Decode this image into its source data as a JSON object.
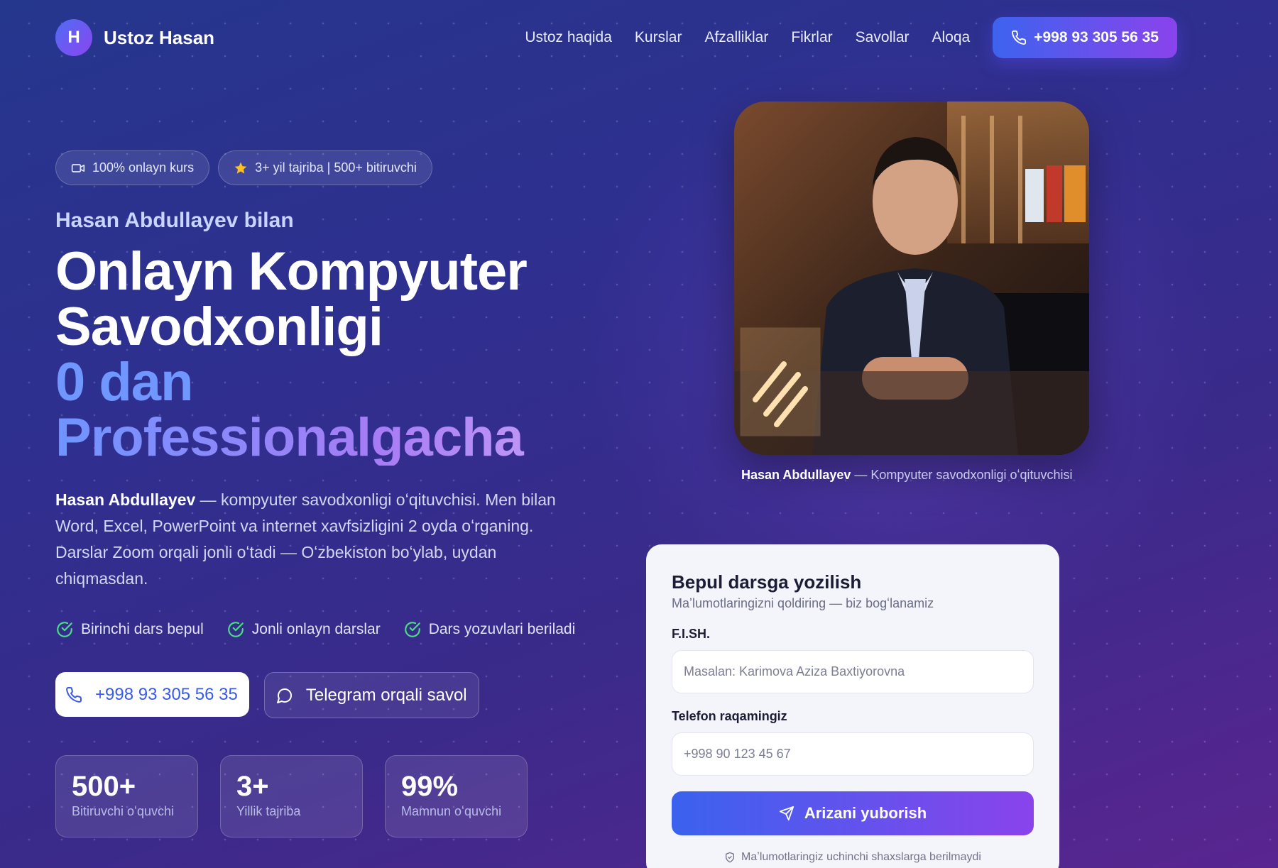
{
  "brand": {
    "initial": "H",
    "name": "Ustoz Hasan"
  },
  "nav": {
    "items": [
      "Ustoz haqida",
      "Kurslar",
      "Afzalliklar",
      "Fikrlar",
      "Savollar",
      "Aloqa"
    ],
    "phone": "+998 93 305 56 35"
  },
  "badges": [
    "100% onlayn kurs",
    "3+ yil tajriba | 500+ bitiruvchi"
  ],
  "hero": {
    "subtitle": "Hasan Abdullayev bilan",
    "title_line1": "Onlayn Kompyuter",
    "title_line2": "Savodxonligi",
    "title_line3": "0 dan",
    "title_line4": "Professionalgacha",
    "desc_name": "Hasan Abdullayev",
    "desc_rest": " — kompyuter savodxonligi oʻqituvchisi. Men bilan Word, Excel, PowerPoint va internet xavfsizligini 2 oyda oʻrganing. Darslar Zoom orqali jonli oʻtadi — Oʻzbekiston boʻylab, uydan chiqmasdan."
  },
  "checks": [
    "Birinchi dars bepul",
    "Jonli onlayn darslar",
    "Dars yozuvlari beriladi"
  ],
  "cta": {
    "phone": "+998 93 305 56 35",
    "telegram": "Telegram orqali savol"
  },
  "stats": [
    {
      "value": "500+",
      "label": "Bitiruvchi oʻquvchi"
    },
    {
      "value": "3+",
      "label": "Yillik tajriba"
    },
    {
      "value": "99%",
      "label": "Mamnun oʻquvchi"
    }
  ],
  "photo": {
    "caption_name": "Hasan Abdullayev",
    "caption_rest": " — Kompyuter savodxonligi oʻqituvchisi"
  },
  "form": {
    "title": "Bepul darsga yozilish",
    "subtitle": "Maʼlumotlaringizni qoldiring — biz bogʻlanamiz",
    "name_label": "F.I.SH.",
    "name_placeholder": "Masalan: Karimova Aziza Baxtiyorovna",
    "phone_label": "Telefon raqamingiz",
    "phone_placeholder": "+998 90 123 45 67",
    "submit": "Arizani yuborish",
    "privacy": "Maʼlumotlaringiz uchinchi shaxslarga berilmaydi"
  },
  "colors": {
    "accent_blue": "#3d63ee",
    "accent_purple": "#8a43ec",
    "check_green": "#4ade80"
  }
}
